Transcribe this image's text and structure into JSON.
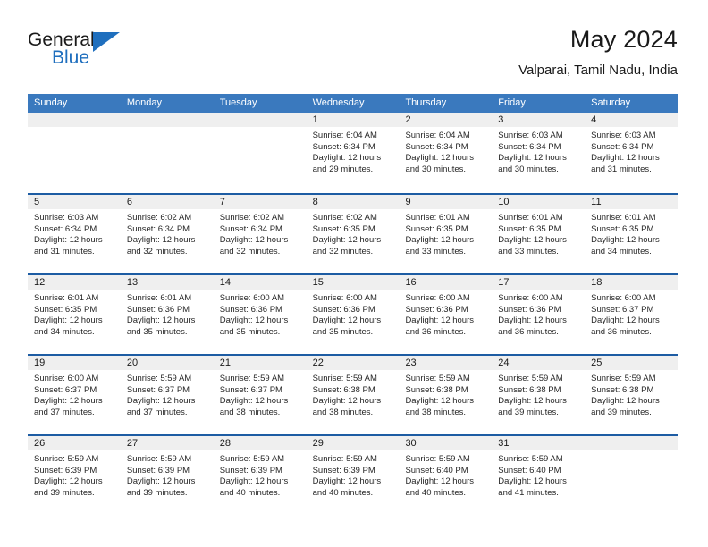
{
  "brand": {
    "name_top": "General",
    "name_bottom": "Blue",
    "logo_icon": "triangle-icon",
    "accent_color": "#1f6fbe"
  },
  "header": {
    "title": "May 2024",
    "subtitle": "Valparai, Tamil Nadu, India"
  },
  "colors": {
    "header_bar": "#3a79be",
    "week_separator": "#1d5ca3",
    "daynum_band": "#efefef"
  },
  "calendar": {
    "day_names": [
      "Sunday",
      "Monday",
      "Tuesday",
      "Wednesday",
      "Thursday",
      "Friday",
      "Saturday"
    ],
    "weeks": [
      [
        {
          "day": "",
          "lines": []
        },
        {
          "day": "",
          "lines": []
        },
        {
          "day": "",
          "lines": []
        },
        {
          "day": "1",
          "lines": [
            "Sunrise: 6:04 AM",
            "Sunset: 6:34 PM",
            "Daylight: 12 hours",
            "and 29 minutes."
          ]
        },
        {
          "day": "2",
          "lines": [
            "Sunrise: 6:04 AM",
            "Sunset: 6:34 PM",
            "Daylight: 12 hours",
            "and 30 minutes."
          ]
        },
        {
          "day": "3",
          "lines": [
            "Sunrise: 6:03 AM",
            "Sunset: 6:34 PM",
            "Daylight: 12 hours",
            "and 30 minutes."
          ]
        },
        {
          "day": "4",
          "lines": [
            "Sunrise: 6:03 AM",
            "Sunset: 6:34 PM",
            "Daylight: 12 hours",
            "and 31 minutes."
          ]
        }
      ],
      [
        {
          "day": "5",
          "lines": [
            "Sunrise: 6:03 AM",
            "Sunset: 6:34 PM",
            "Daylight: 12 hours",
            "and 31 minutes."
          ]
        },
        {
          "day": "6",
          "lines": [
            "Sunrise: 6:02 AM",
            "Sunset: 6:34 PM",
            "Daylight: 12 hours",
            "and 32 minutes."
          ]
        },
        {
          "day": "7",
          "lines": [
            "Sunrise: 6:02 AM",
            "Sunset: 6:34 PM",
            "Daylight: 12 hours",
            "and 32 minutes."
          ]
        },
        {
          "day": "8",
          "lines": [
            "Sunrise: 6:02 AM",
            "Sunset: 6:35 PM",
            "Daylight: 12 hours",
            "and 32 minutes."
          ]
        },
        {
          "day": "9",
          "lines": [
            "Sunrise: 6:01 AM",
            "Sunset: 6:35 PM",
            "Daylight: 12 hours",
            "and 33 minutes."
          ]
        },
        {
          "day": "10",
          "lines": [
            "Sunrise: 6:01 AM",
            "Sunset: 6:35 PM",
            "Daylight: 12 hours",
            "and 33 minutes."
          ]
        },
        {
          "day": "11",
          "lines": [
            "Sunrise: 6:01 AM",
            "Sunset: 6:35 PM",
            "Daylight: 12 hours",
            "and 34 minutes."
          ]
        }
      ],
      [
        {
          "day": "12",
          "lines": [
            "Sunrise: 6:01 AM",
            "Sunset: 6:35 PM",
            "Daylight: 12 hours",
            "and 34 minutes."
          ]
        },
        {
          "day": "13",
          "lines": [
            "Sunrise: 6:01 AM",
            "Sunset: 6:36 PM",
            "Daylight: 12 hours",
            "and 35 minutes."
          ]
        },
        {
          "day": "14",
          "lines": [
            "Sunrise: 6:00 AM",
            "Sunset: 6:36 PM",
            "Daylight: 12 hours",
            "and 35 minutes."
          ]
        },
        {
          "day": "15",
          "lines": [
            "Sunrise: 6:00 AM",
            "Sunset: 6:36 PM",
            "Daylight: 12 hours",
            "and 35 minutes."
          ]
        },
        {
          "day": "16",
          "lines": [
            "Sunrise: 6:00 AM",
            "Sunset: 6:36 PM",
            "Daylight: 12 hours",
            "and 36 minutes."
          ]
        },
        {
          "day": "17",
          "lines": [
            "Sunrise: 6:00 AM",
            "Sunset: 6:36 PM",
            "Daylight: 12 hours",
            "and 36 minutes."
          ]
        },
        {
          "day": "18",
          "lines": [
            "Sunrise: 6:00 AM",
            "Sunset: 6:37 PM",
            "Daylight: 12 hours",
            "and 36 minutes."
          ]
        }
      ],
      [
        {
          "day": "19",
          "lines": [
            "Sunrise: 6:00 AM",
            "Sunset: 6:37 PM",
            "Daylight: 12 hours",
            "and 37 minutes."
          ]
        },
        {
          "day": "20",
          "lines": [
            "Sunrise: 5:59 AM",
            "Sunset: 6:37 PM",
            "Daylight: 12 hours",
            "and 37 minutes."
          ]
        },
        {
          "day": "21",
          "lines": [
            "Sunrise: 5:59 AM",
            "Sunset: 6:37 PM",
            "Daylight: 12 hours",
            "and 38 minutes."
          ]
        },
        {
          "day": "22",
          "lines": [
            "Sunrise: 5:59 AM",
            "Sunset: 6:38 PM",
            "Daylight: 12 hours",
            "and 38 minutes."
          ]
        },
        {
          "day": "23",
          "lines": [
            "Sunrise: 5:59 AM",
            "Sunset: 6:38 PM",
            "Daylight: 12 hours",
            "and 38 minutes."
          ]
        },
        {
          "day": "24",
          "lines": [
            "Sunrise: 5:59 AM",
            "Sunset: 6:38 PM",
            "Daylight: 12 hours",
            "and 39 minutes."
          ]
        },
        {
          "day": "25",
          "lines": [
            "Sunrise: 5:59 AM",
            "Sunset: 6:38 PM",
            "Daylight: 12 hours",
            "and 39 minutes."
          ]
        }
      ],
      [
        {
          "day": "26",
          "lines": [
            "Sunrise: 5:59 AM",
            "Sunset: 6:39 PM",
            "Daylight: 12 hours",
            "and 39 minutes."
          ]
        },
        {
          "day": "27",
          "lines": [
            "Sunrise: 5:59 AM",
            "Sunset: 6:39 PM",
            "Daylight: 12 hours",
            "and 39 minutes."
          ]
        },
        {
          "day": "28",
          "lines": [
            "Sunrise: 5:59 AM",
            "Sunset: 6:39 PM",
            "Daylight: 12 hours",
            "and 40 minutes."
          ]
        },
        {
          "day": "29",
          "lines": [
            "Sunrise: 5:59 AM",
            "Sunset: 6:39 PM",
            "Daylight: 12 hours",
            "and 40 minutes."
          ]
        },
        {
          "day": "30",
          "lines": [
            "Sunrise: 5:59 AM",
            "Sunset: 6:40 PM",
            "Daylight: 12 hours",
            "and 40 minutes."
          ]
        },
        {
          "day": "31",
          "lines": [
            "Sunrise: 5:59 AM",
            "Sunset: 6:40 PM",
            "Daylight: 12 hours",
            "and 41 minutes."
          ]
        },
        {
          "day": "",
          "lines": []
        }
      ]
    ]
  }
}
